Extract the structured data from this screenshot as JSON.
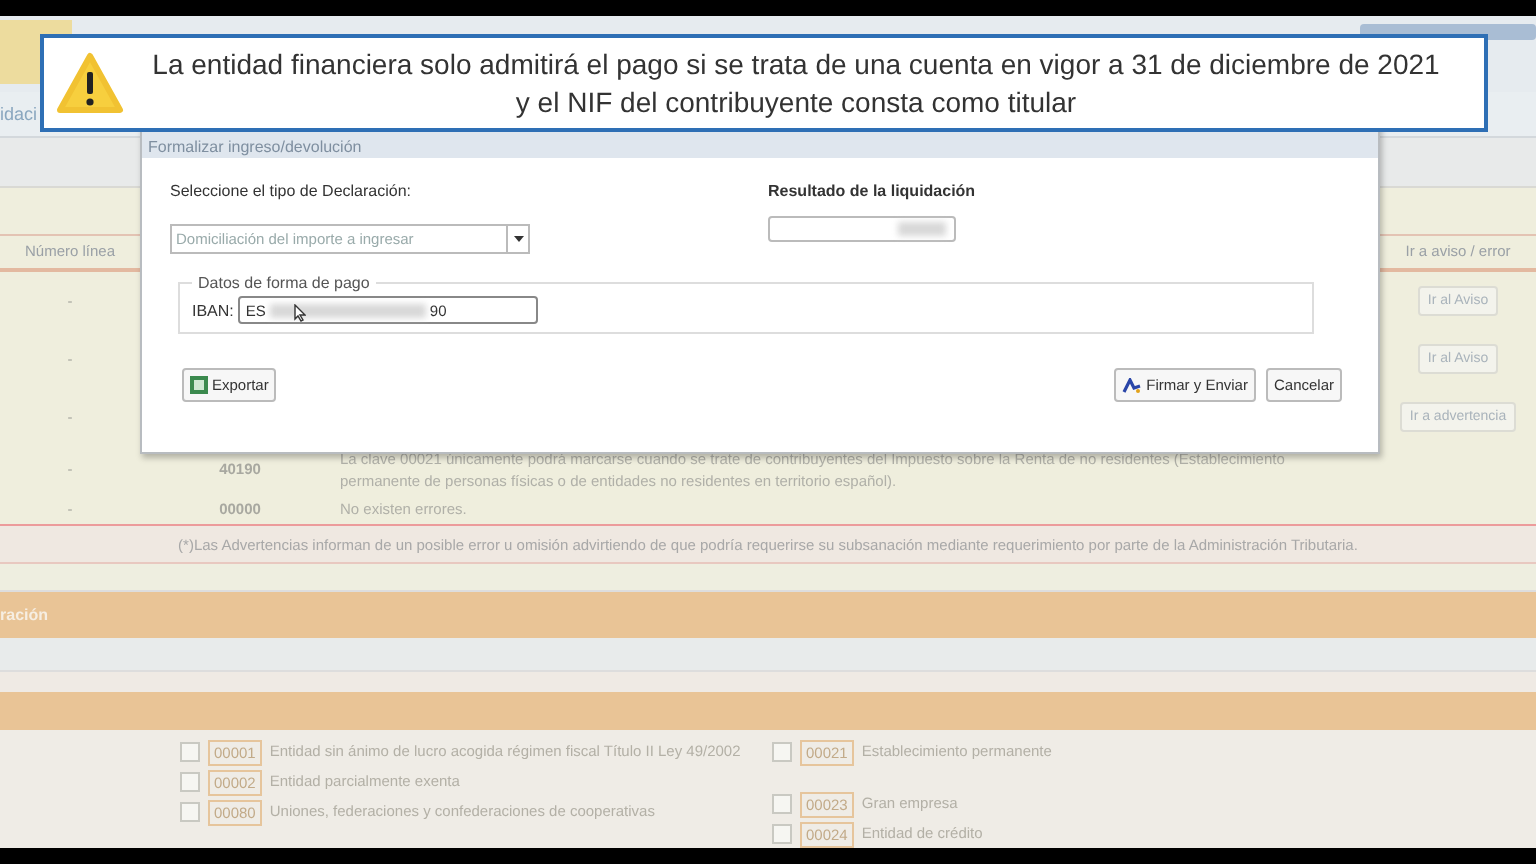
{
  "callout": {
    "text_lines": [
      "La entidad financiera solo admitirá el pago si se trata de una cuenta en vigor a 31 de diciembre de 2021",
      "y el NIF del contribuyente consta como titular"
    ]
  },
  "page": {
    "tab": "idaci",
    "table": {
      "columns": [
        "Número línea",
        "Ir a aviso / error"
      ],
      "rows": [
        {
          "line": "-",
          "code": "",
          "text": [],
          "action": "Ir al Aviso"
        },
        {
          "line": "-",
          "code": "",
          "text": [],
          "action": "Ir al Aviso"
        },
        {
          "line": "-",
          "code": "",
          "text": [],
          "action": "Ir a advertencia"
        },
        {
          "line": "-",
          "code": "40190",
          "text": [
            "La clave 00021 únicamente podrá marcarse cuando se trate de contribuyentes del Impuesto sobre la Renta de no residentes (Establecimiento",
            "permanente de personas físicas o de entidades no residentes en territorio español)."
          ],
          "action": ""
        },
        {
          "line": "-",
          "code": "00000",
          "text": [
            "No existen errores."
          ],
          "action": ""
        }
      ],
      "note": "(*)Las Advertencias informan de un posible error u omisión advirtiendo de que podría requerirse su subsanación mediante requerimiento por parte de la Administración Tributaria."
    },
    "section_title": "ración",
    "keys_left": [
      {
        "code": "00001",
        "label": "Entidad sin ánimo de lucro acogida régimen fiscal Título II Ley 49/2002",
        "checked": false
      },
      {
        "code": "00002",
        "label": "Entidad parcialmente exenta",
        "checked": false
      },
      {
        "code": "00080",
        "label": "Uniones, federaciones y confederaciones de cooperativas",
        "checked": false
      }
    ],
    "keys_right": [
      {
        "code": "00021",
        "label": "Establecimiento permanente",
        "checked": false
      },
      {
        "code": "00023",
        "label": "Gran empresa",
        "checked": false
      },
      {
        "code": "00024",
        "label": "Entidad de crédito",
        "checked": false
      }
    ]
  },
  "dialog": {
    "title": "Formalizar ingreso/devolución",
    "type_label": "Seleccione el tipo de Declaración:",
    "type_value": "Domiciliación del importe a ingresar",
    "result_label": "Resultado de la liquidación",
    "payment_legend": "Datos de forma de pago",
    "iban_label": "IBAN:",
    "iban_start": "ES",
    "iban_end": "90",
    "buttons": [
      {
        "label": "Exportar",
        "kind": "export"
      },
      {
        "label": "Firmar y Enviar",
        "kind": "sign"
      },
      {
        "label": "Cancelar",
        "kind": "plain"
      }
    ]
  }
}
